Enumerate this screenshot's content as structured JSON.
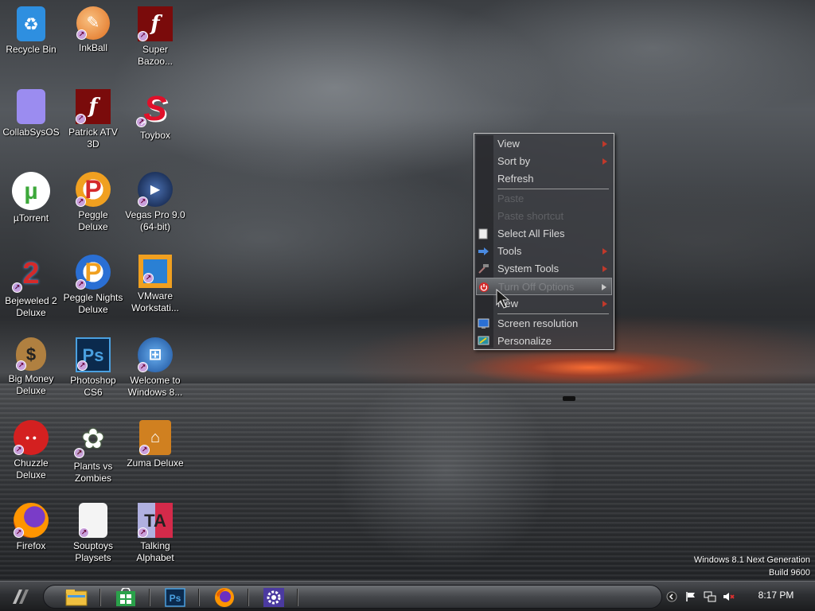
{
  "desktop": {
    "icons": [
      {
        "label": "Recycle Bin",
        "icon": "recycle-bin-icon",
        "color": "#2e8fe0"
      },
      {
        "label": "InkBall",
        "icon": "inkball-icon",
        "color": "#e07020"
      },
      {
        "label": "Super Bazoo...",
        "icon": "flash-icon",
        "color": "#7a0b0b"
      },
      {
        "label": "CollabSysOS",
        "icon": "collabsysos-icon",
        "color": "#9b8cf0"
      },
      {
        "label": "Patrick ATV 3D",
        "icon": "flash-icon",
        "color": "#7a0b0b"
      },
      {
        "label": "Toybox",
        "icon": "toybox-icon",
        "color": "#e0102a"
      },
      {
        "label": "µTorrent",
        "icon": "utorrent-icon",
        "color": "#3da83a"
      },
      {
        "label": "Peggle Deluxe",
        "icon": "peggle-icon",
        "color": "#f0a020"
      },
      {
        "label": "Vegas Pro 9.0 (64-bit)",
        "icon": "vegas-icon",
        "color": "#1f3b7a"
      },
      {
        "label": "Bejeweled 2 Deluxe",
        "icon": "bejeweled-icon",
        "color": "#d42a2a"
      },
      {
        "label": "Peggle Nights Deluxe",
        "icon": "peggle-nights-icon",
        "color": "#2a6fd4"
      },
      {
        "label": "VMware Workstati...",
        "icon": "vmware-icon",
        "color": "#f0a020"
      },
      {
        "label": "Big Money Deluxe",
        "icon": "money-bag-icon",
        "color": "#b08040"
      },
      {
        "label": "Photoshop CS6",
        "icon": "photoshop-icon",
        "color": "#0b2a4d"
      },
      {
        "label": "Welcome to Windows 8...",
        "icon": "windows-logo-icon",
        "color": "#2a80d4"
      },
      {
        "label": "Chuzzle Deluxe",
        "icon": "chuzzle-icon",
        "color": "#d42020"
      },
      {
        "label": "Plants vs Zombies",
        "icon": "plants-vs-zombies-icon",
        "color": "#6aa84f"
      },
      {
        "label": "Zuma Deluxe",
        "icon": "zuma-icon",
        "color": "#d08020"
      },
      {
        "label": "Firefox",
        "icon": "firefox-icon",
        "color": "#e66000"
      },
      {
        "label": "Souptoys Playsets",
        "icon": "souptoys-icon",
        "color": "#f4f4f4"
      },
      {
        "label": "Talking Alphabet",
        "icon": "talking-alphabet-icon",
        "color": "#d42a4a"
      }
    ]
  },
  "context_menu": {
    "view": "View",
    "sort_by": "Sort by",
    "refresh": "Refresh",
    "paste": "Paste",
    "paste_shortcut": "Paste shortcut",
    "select_all": "Select All Files",
    "tools": "Tools",
    "system_tools": "System Tools",
    "turn_off": "Turn Off Options",
    "new": "New",
    "screen_resolution": "Screen resolution",
    "personalize": "Personalize"
  },
  "watermark": {
    "line1": "Windows 8.1 Next Generation",
    "line2": "Build 9600"
  },
  "taskbar": {
    "apps": [
      "file-explorer-icon",
      "store-icon",
      "photoshop-icon",
      "firefox-icon",
      "settings-gear-icon"
    ],
    "clock": "8:17 PM"
  }
}
